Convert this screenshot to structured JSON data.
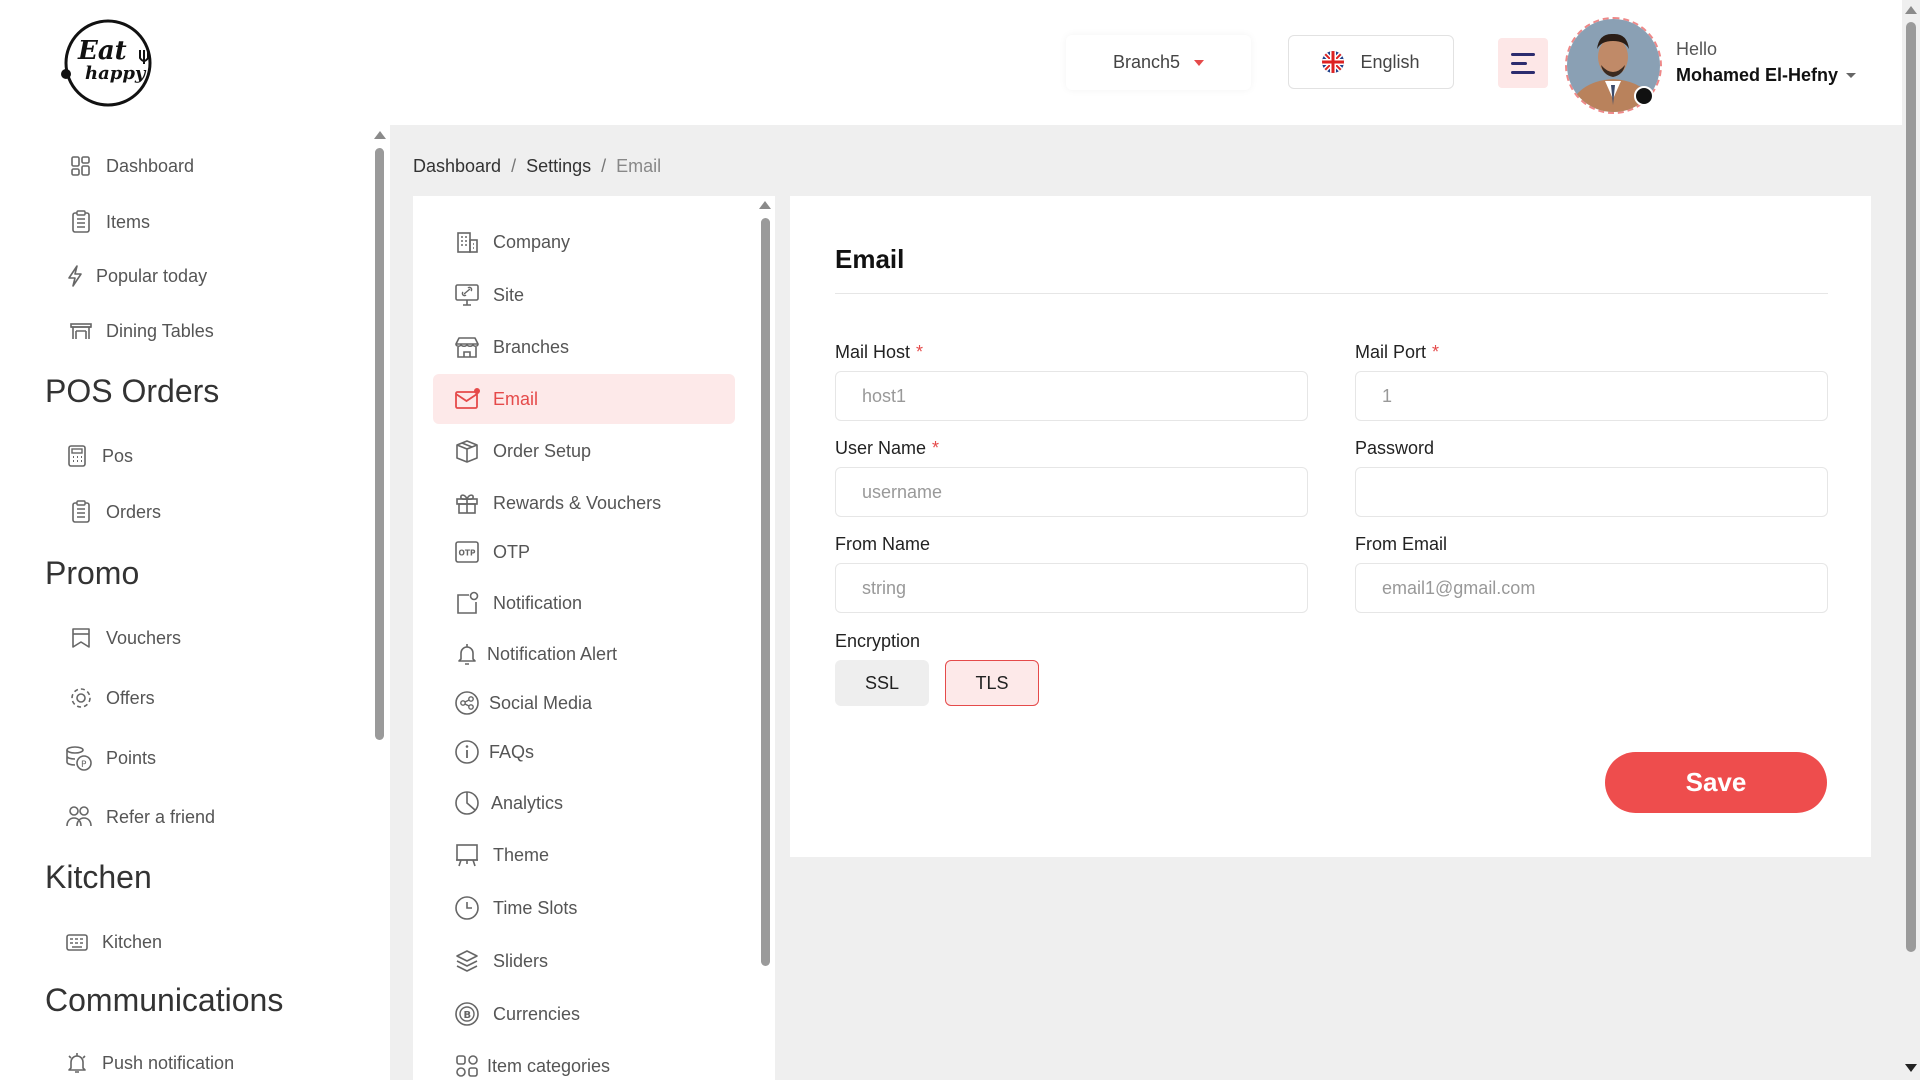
{
  "header": {
    "logo_text_1": "Eat",
    "logo_text_2": "happy",
    "branch": "Branch5",
    "language": "English",
    "greeting": "Hello",
    "user_name": "Mohamed El-Hefny"
  },
  "sidebar": {
    "items_top": [
      {
        "label": "Dashboard",
        "icon": "dashboard-icon"
      },
      {
        "label": "Items",
        "icon": "clipboard-icon"
      },
      {
        "label": "Popular today",
        "icon": "lightning-icon"
      },
      {
        "label": "Dining Tables",
        "icon": "table-icon"
      }
    ],
    "headings": {
      "pos": "POS Orders",
      "promo": "Promo",
      "kitchen": "Kitchen",
      "communications": "Communications"
    },
    "pos_items": [
      {
        "label": "Pos",
        "icon": "calculator-icon"
      },
      {
        "label": "Orders",
        "icon": "clipboard-icon"
      }
    ],
    "promo_items": [
      {
        "label": "Vouchers",
        "icon": "voucher-icon"
      },
      {
        "label": "Offers",
        "icon": "gear-icon"
      },
      {
        "label": "Points",
        "icon": "coins-icon"
      },
      {
        "label": "Refer a friend",
        "icon": "users-icon"
      }
    ],
    "kitchen_items": [
      {
        "label": "Kitchen",
        "icon": "kitchen-icon"
      }
    ],
    "communications_items": [
      {
        "label": "Push notification",
        "icon": "bell-icon"
      }
    ]
  },
  "breadcrumb": {
    "items": [
      "Dashboard",
      "Settings"
    ],
    "current": "Email",
    "separator": "/"
  },
  "settings_menu": [
    {
      "label": "Company",
      "icon": "building-icon"
    },
    {
      "label": "Site",
      "icon": "monitor-link-icon"
    },
    {
      "label": "Branches",
      "icon": "store-icon"
    },
    {
      "label": "Email",
      "icon": "mail-icon",
      "active": true
    },
    {
      "label": "Order Setup",
      "icon": "box-icon"
    },
    {
      "label": "Rewards & Vouchers",
      "icon": "gift-icon"
    },
    {
      "label": "OTP",
      "icon": "otp-icon"
    },
    {
      "label": "Notification",
      "icon": "notification-icon"
    },
    {
      "label": "Notification Alert",
      "icon": "bell-icon"
    },
    {
      "label": "Social Media",
      "icon": "share-icon"
    },
    {
      "label": "FAQs",
      "icon": "info-icon"
    },
    {
      "label": "Analytics",
      "icon": "pie-icon"
    },
    {
      "label": "Theme",
      "icon": "easel-icon"
    },
    {
      "label": "Time Slots",
      "icon": "clock-icon"
    },
    {
      "label": "Sliders",
      "icon": "layers-icon"
    },
    {
      "label": "Currencies",
      "icon": "currency-icon"
    },
    {
      "label": "Item categories",
      "icon": "grid-icon"
    }
  ],
  "form": {
    "title": "Email",
    "mail_host": {
      "label": "Mail Host",
      "placeholder": "host1",
      "required": true
    },
    "mail_port": {
      "label": "Mail Port",
      "placeholder": "1",
      "required": true
    },
    "user_name": {
      "label": "User Name",
      "placeholder": "username",
      "required": true
    },
    "password": {
      "label": "Password",
      "placeholder": "",
      "required": false
    },
    "from_name": {
      "label": "From Name",
      "placeholder": "string",
      "required": false
    },
    "from_email": {
      "label": "From Email",
      "placeholder": "email1@gmail.com",
      "required": false
    },
    "encryption_label": "Encryption",
    "encryption_options": [
      "SSL",
      "TLS"
    ],
    "encryption_selected": "TLS",
    "save_label": "Save",
    "required_mark": "*"
  },
  "colors": {
    "accent": "#ee4d4d",
    "accent_light": "#fde9e9",
    "background": "#efefef"
  }
}
